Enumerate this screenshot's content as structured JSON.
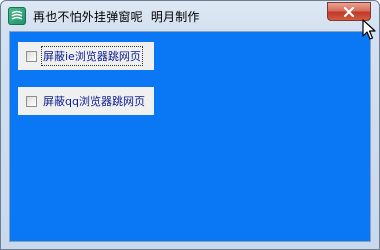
{
  "window": {
    "title": "再也不怕外挂弹窗呢  明月制作",
    "close_label": "✕"
  },
  "options": [
    {
      "label": "屏蔽ie浏览器跳网页",
      "checked": false,
      "focused": true
    },
    {
      "label": "屏蔽qq浏览器跳网页",
      "checked": false,
      "focused": false
    }
  ],
  "icons": {
    "app": "app-icon",
    "close": "close-icon",
    "cursor": "mouse-cursor-icon"
  },
  "colors": {
    "client_background": "#0a78f5",
    "close_button": "#c0392b",
    "label_text": "#0b1d8f"
  }
}
